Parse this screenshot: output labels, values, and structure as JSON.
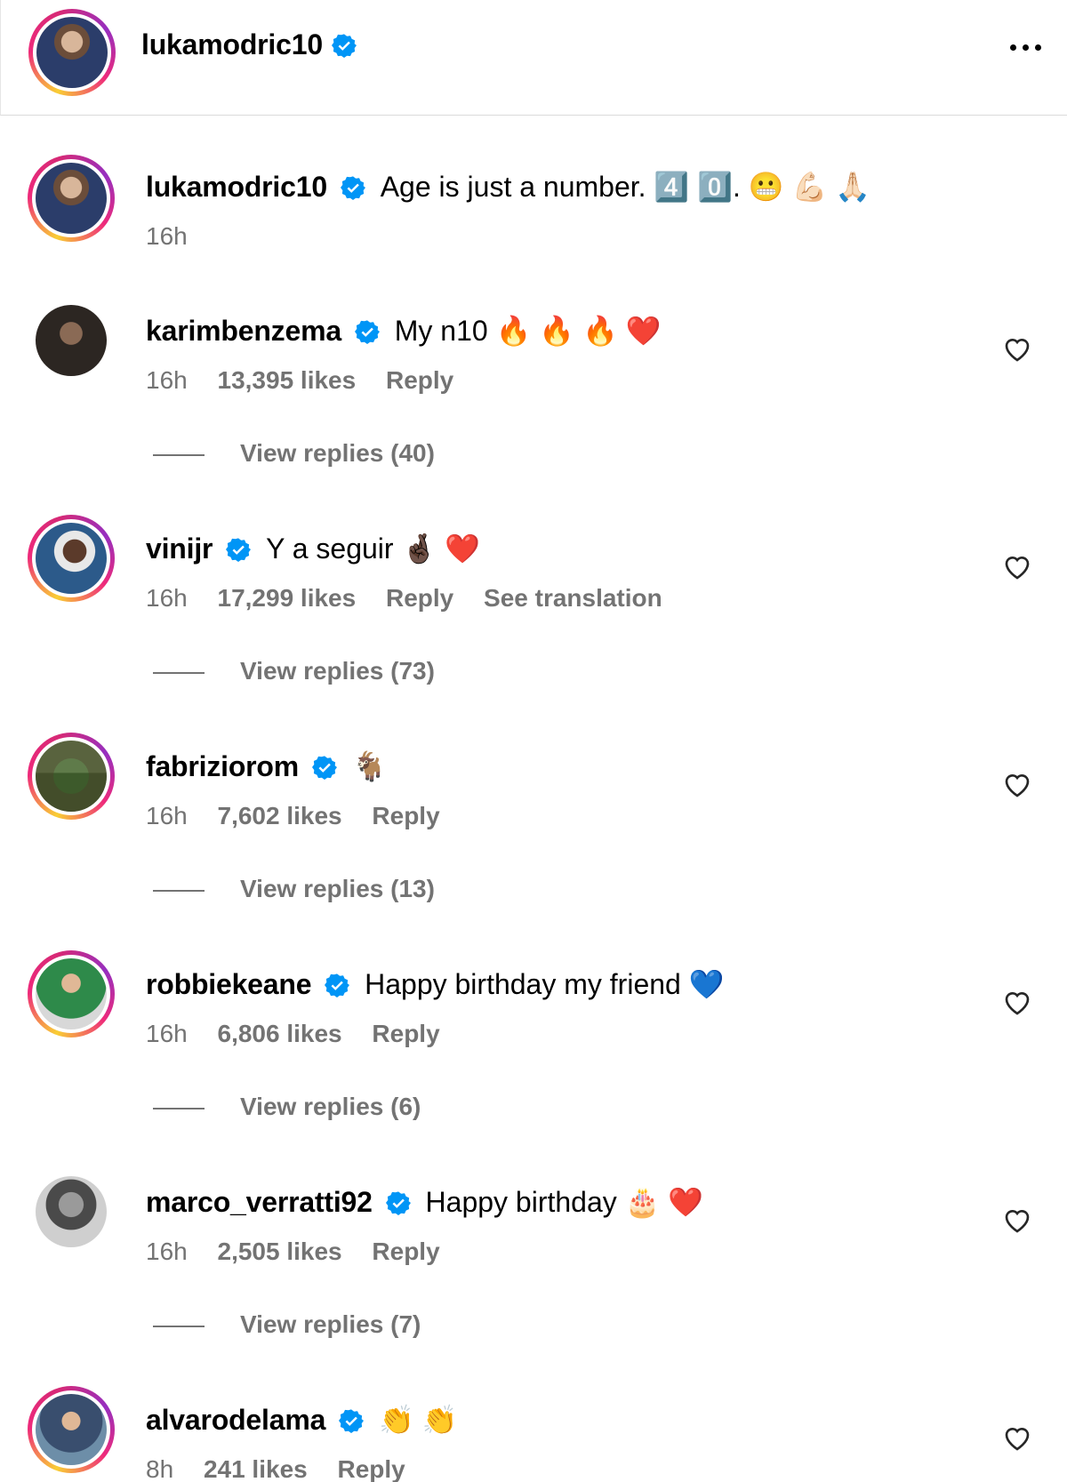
{
  "post": {
    "username": "lukamodric10",
    "verified": true,
    "caption": "Age is just a number. 4️⃣ 0️⃣. 😬 💪🏻 🙏🏻",
    "time": "16h"
  },
  "comments": [
    {
      "username": "karimbenzema",
      "text": "My n10 🔥 🔥 🔥 ❤️",
      "time": "16h",
      "likes": "13,395 likes",
      "reply": "Reply",
      "view_replies": "View replies (40)"
    },
    {
      "username": "vinijr",
      "text": "Y a seguir 🤞🏿 ❤️",
      "time": "16h",
      "likes": "17,299 likes",
      "reply": "Reply",
      "translate": "See translation",
      "view_replies": "View replies (73)"
    },
    {
      "username": "fabriziorom",
      "text": "🐐",
      "time": "16h",
      "likes": "7,602 likes",
      "reply": "Reply",
      "view_replies": "View replies (13)"
    },
    {
      "username": "robbiekeane",
      "text": "Happy birthday my friend 💙",
      "time": "16h",
      "likes": "6,806 likes",
      "reply": "Reply",
      "view_replies": "View replies (6)"
    },
    {
      "username": "marco_verratti92",
      "text": "Happy birthday 🎂 ❤️",
      "time": "16h",
      "likes": "2,505 likes",
      "reply": "Reply",
      "view_replies": "View replies (7)"
    },
    {
      "username": "alvarodelama",
      "text": "👏 👏",
      "time": "8h",
      "likes": "241 likes",
      "reply": "Reply"
    }
  ],
  "colors": {
    "verified": "#0095f6",
    "meta": "#737373",
    "heart_red": "#ed4956"
  }
}
